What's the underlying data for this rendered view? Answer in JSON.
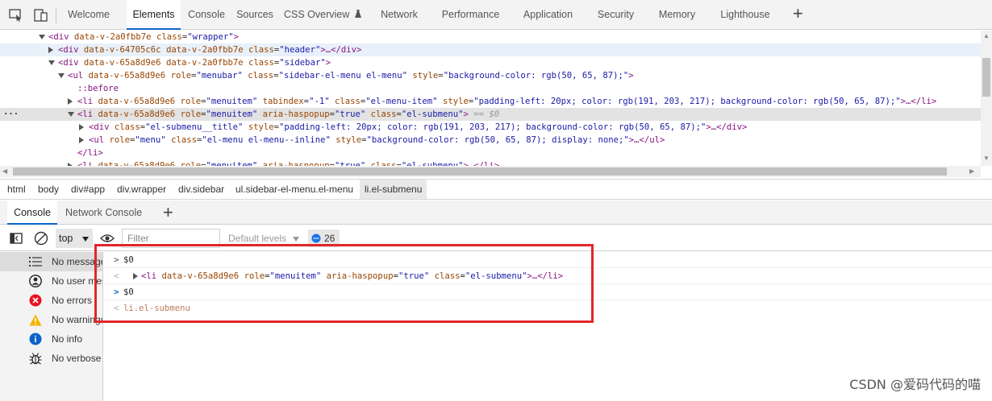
{
  "top_tabs": {
    "items": [
      {
        "label": "Welcome"
      },
      {
        "label": "Elements"
      },
      {
        "label": "Console"
      },
      {
        "label": "Sources"
      },
      {
        "label": "CSS Overview"
      },
      {
        "label": "Network"
      },
      {
        "label": "Performance"
      },
      {
        "label": "Application"
      },
      {
        "label": "Security"
      },
      {
        "label": "Memory"
      },
      {
        "label": "Lighthouse"
      }
    ],
    "active": "Elements",
    "add_icon": "plus-icon"
  },
  "tree": {
    "lines": [
      {
        "tag": "<div ",
        "attrs": [
          [
            "data-v-2a0fbb7e",
            ""
          ],
          [
            "class",
            "\"wrapper\""
          ]
        ],
        "tail": ">"
      },
      {
        "tag": "<div ",
        "attrs": [
          [
            "data-v-64705c6c",
            ""
          ],
          [
            "data-v-2a0fbb7e",
            ""
          ],
          [
            "class",
            "\"header\""
          ]
        ],
        "tail": ">…</div>"
      },
      {
        "tag": "<div ",
        "attrs": [
          [
            "data-v-65a8d9e6",
            ""
          ],
          [
            "data-v-2a0fbb7e",
            ""
          ],
          [
            "class",
            "\"sidebar\""
          ]
        ],
        "tail": ">"
      },
      {
        "tag": "<ul ",
        "attrs": [
          [
            "data-v-65a8d9e6",
            ""
          ],
          [
            "role",
            "\"menubar\""
          ],
          [
            "class",
            "\"sidebar-el-menu el-menu\""
          ],
          [
            "style",
            "\"background-color: rgb(50, 65, 87);\""
          ]
        ],
        "tail": ">"
      },
      {
        "pseudo": "::before"
      },
      {
        "tag": "<li ",
        "attrs": [
          [
            "data-v-65a8d9e6",
            ""
          ],
          [
            "role",
            "\"menuitem\""
          ],
          [
            "tabindex",
            "\"-1\""
          ],
          [
            "class",
            "\"el-menu-item\""
          ],
          [
            "style",
            "\"padding-left: 20px; color: rgb(191, 203, 217); background-color: rgb(50, 65, 87);\""
          ]
        ],
        "tail": ">…</li>"
      },
      {
        "tag": "<li ",
        "attrs": [
          [
            "data-v-65a8d9e6",
            ""
          ],
          [
            "role",
            "\"menuitem\""
          ],
          [
            "aria-haspopup",
            "\"true\""
          ],
          [
            "class",
            "\"el-submenu\""
          ]
        ],
        "tail": ">",
        "suffix": " == $0",
        "dots": "···"
      },
      {
        "tag": "<div ",
        "attrs": [
          [
            "class",
            "\"el-submenu__title\""
          ],
          [
            "style",
            "\"padding-left: 20px; color: rgb(191, 203, 217); background-color: rgb(50, 65, 87);\""
          ]
        ],
        "tail": ">…</div>"
      },
      {
        "tag": "<ul ",
        "attrs": [
          [
            "role",
            "\"menu\""
          ],
          [
            "class",
            "\"el-menu el-menu--inline\""
          ],
          [
            "style",
            "\"background-color: rgb(50, 65, 87); display: none;\""
          ]
        ],
        "tail": ">…</ul>"
      },
      {
        "tag": "</li>",
        "attrs": [],
        "tail": ""
      },
      {
        "tag": "<li ",
        "attrs": [
          [
            "data-v-65a8d9e6",
            ""
          ],
          [
            "role",
            "\"menuitem\""
          ],
          [
            "aria-haspopup",
            "\"true\""
          ],
          [
            "class",
            "\"el-submenu\""
          ]
        ],
        "tail": ">…</li>"
      }
    ]
  },
  "breadcrumb": {
    "items": [
      "html",
      "body",
      "div#app",
      "div.wrapper",
      "div.sidebar",
      "ul.sidebar-el-menu.el-menu",
      "li.el-submenu"
    ],
    "active": "li.el-submenu"
  },
  "drawer_tabs": {
    "items": [
      "Console",
      "Network Console"
    ],
    "active": "Console",
    "add_icon": "plus-icon"
  },
  "console_toolbar": {
    "context": "top",
    "filter_placeholder": "Filter",
    "levels_label": "Default levels",
    "issues_count": "26"
  },
  "sidebar": {
    "items": [
      {
        "label": "No messages",
        "icon": "list-icon"
      },
      {
        "label": "No user messages",
        "icon": "user-icon"
      },
      {
        "label": "No errors",
        "icon": "error-icon",
        "color": "#e81123"
      },
      {
        "label": "No warnings",
        "icon": "warning-icon",
        "color": "#f4b400"
      },
      {
        "label": "No info",
        "icon": "info-icon",
        "color": "#0a64c8"
      },
      {
        "label": "No verbose",
        "icon": "bug-icon"
      }
    ]
  },
  "console": {
    "entries": [
      {
        "kind": "input",
        "text": "$0"
      },
      {
        "kind": "output",
        "text": "<li data-v-65a8d9e6 role=\"menuitem\" aria-haspopup=\"true\" class=\"el-submenu\">…</li>"
      },
      {
        "kind": "input",
        "text": "$0"
      },
      {
        "kind": "output",
        "text": "li.el-submenu"
      }
    ]
  },
  "watermark": "CSDN @爱码代码的喵"
}
